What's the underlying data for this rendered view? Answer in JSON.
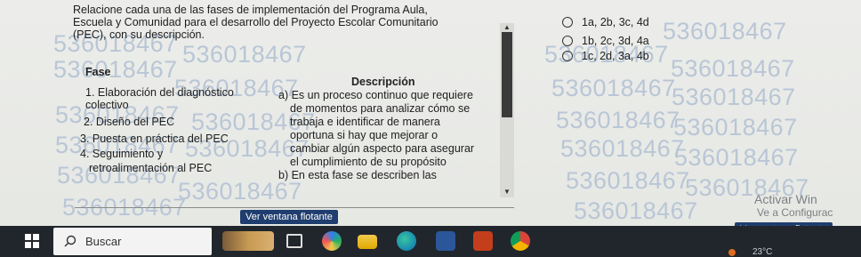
{
  "question": {
    "line1": "Relacione cada una de las fases de implementación del Programa Aula,",
    "line2": "Escuela y Comunidad para el desarrollo del Proyecto Escolar Comunitario",
    "line3": "(PEC), con su descripción."
  },
  "table": {
    "fase_header": "Fase",
    "descripcion_header": "Descripción",
    "fases": [
      "1. Elaboración del diagnóstico",
      "colectivo",
      "2. Diseño del PEC",
      "3. Puesta en práctica del PEC",
      "4. Seguimiento y",
      "retroalimentación al PEC"
    ],
    "descripcion_lines": [
      "a) Es un proceso continuo que requiere",
      "de momentos para analizar cómo se",
      "trabaja e identificar de manera",
      "oportuna si hay que mejorar o",
      "cambiar algún aspecto para asegurar",
      "el cumplimiento de su propósito",
      "b) En esta fase se describen las"
    ]
  },
  "options": [
    "1a, 2b, 3c, 4d",
    "1b, 2c, 3d, 4a",
    "1c, 2d, 3a, 4b"
  ],
  "watermark": "536018467",
  "float_button_label": "Ver ventana flotante",
  "activate": {
    "line1": "Activar Win",
    "line2": "Ve a Configurac"
  },
  "taskbar": {
    "search_label": "Buscar",
    "temperature": "23°C"
  },
  "colors": {
    "watermark": "#b9c6d6",
    "float_button": "#1f3d6e",
    "taskbar": "#20262c"
  }
}
